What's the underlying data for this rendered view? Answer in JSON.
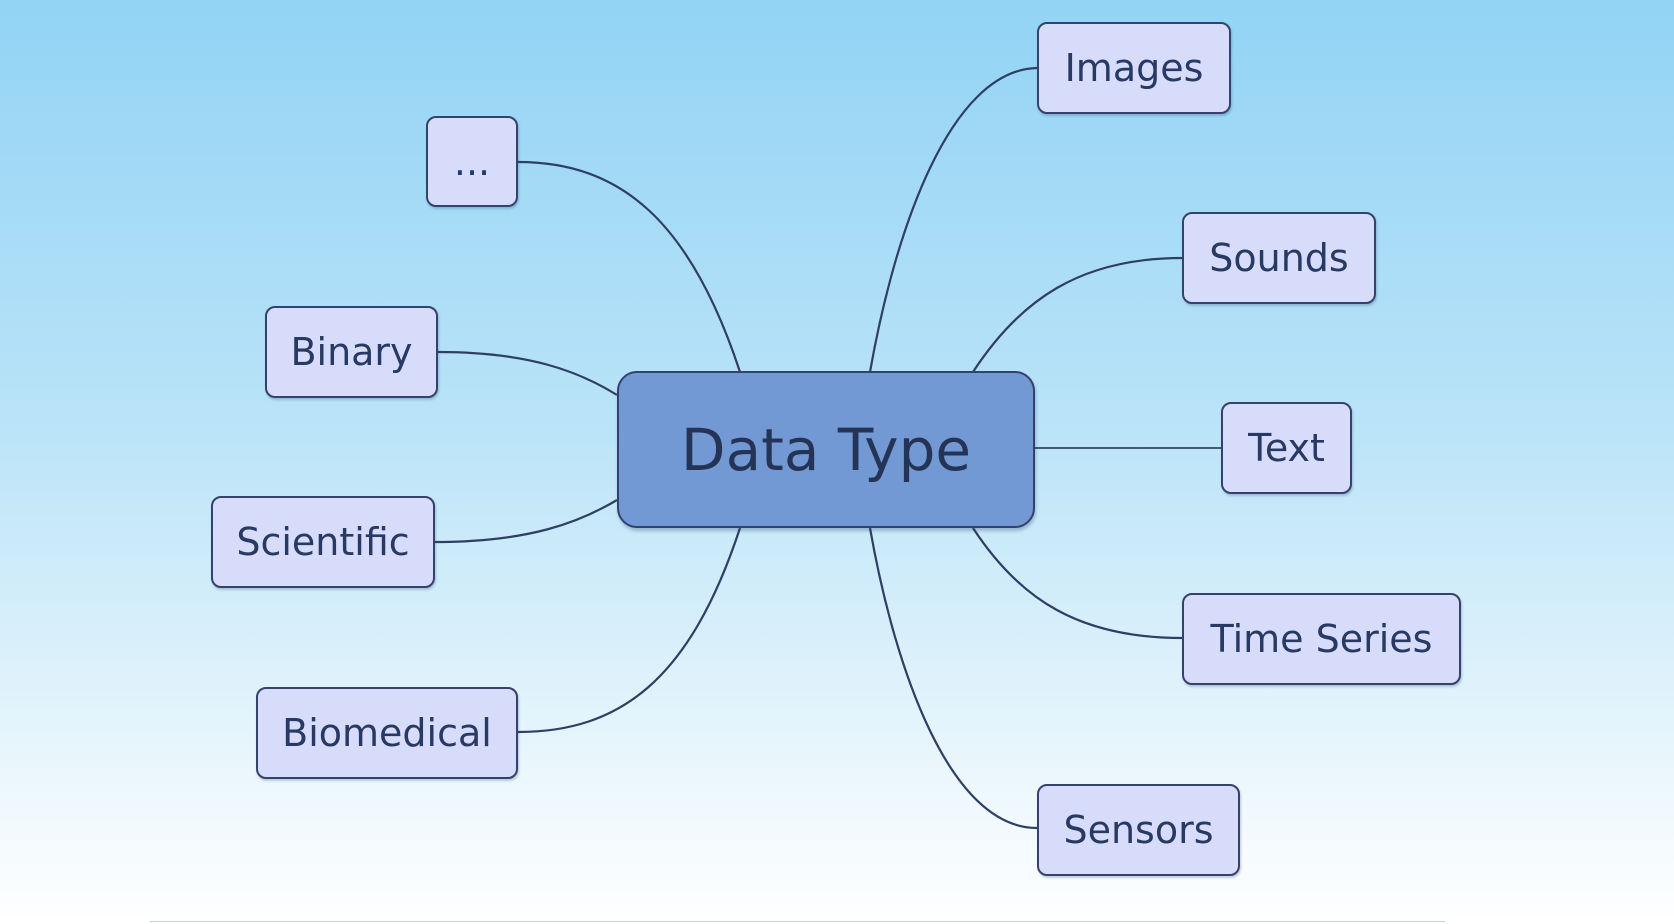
{
  "diagram": {
    "center": "Data Type",
    "left_nodes": [
      "...",
      "Binary",
      "Scientific",
      "Biomedical"
    ],
    "right_nodes": [
      "Images",
      "Sounds",
      "Text",
      "Time Series",
      "Sensors"
    ]
  },
  "colors": {
    "center_fill": "#7399d4",
    "node_fill": "#d7dcfb",
    "border": "#35426b",
    "text": "#283a63",
    "background_top": "#92d3f5",
    "background_bottom": "#ffffff"
  }
}
